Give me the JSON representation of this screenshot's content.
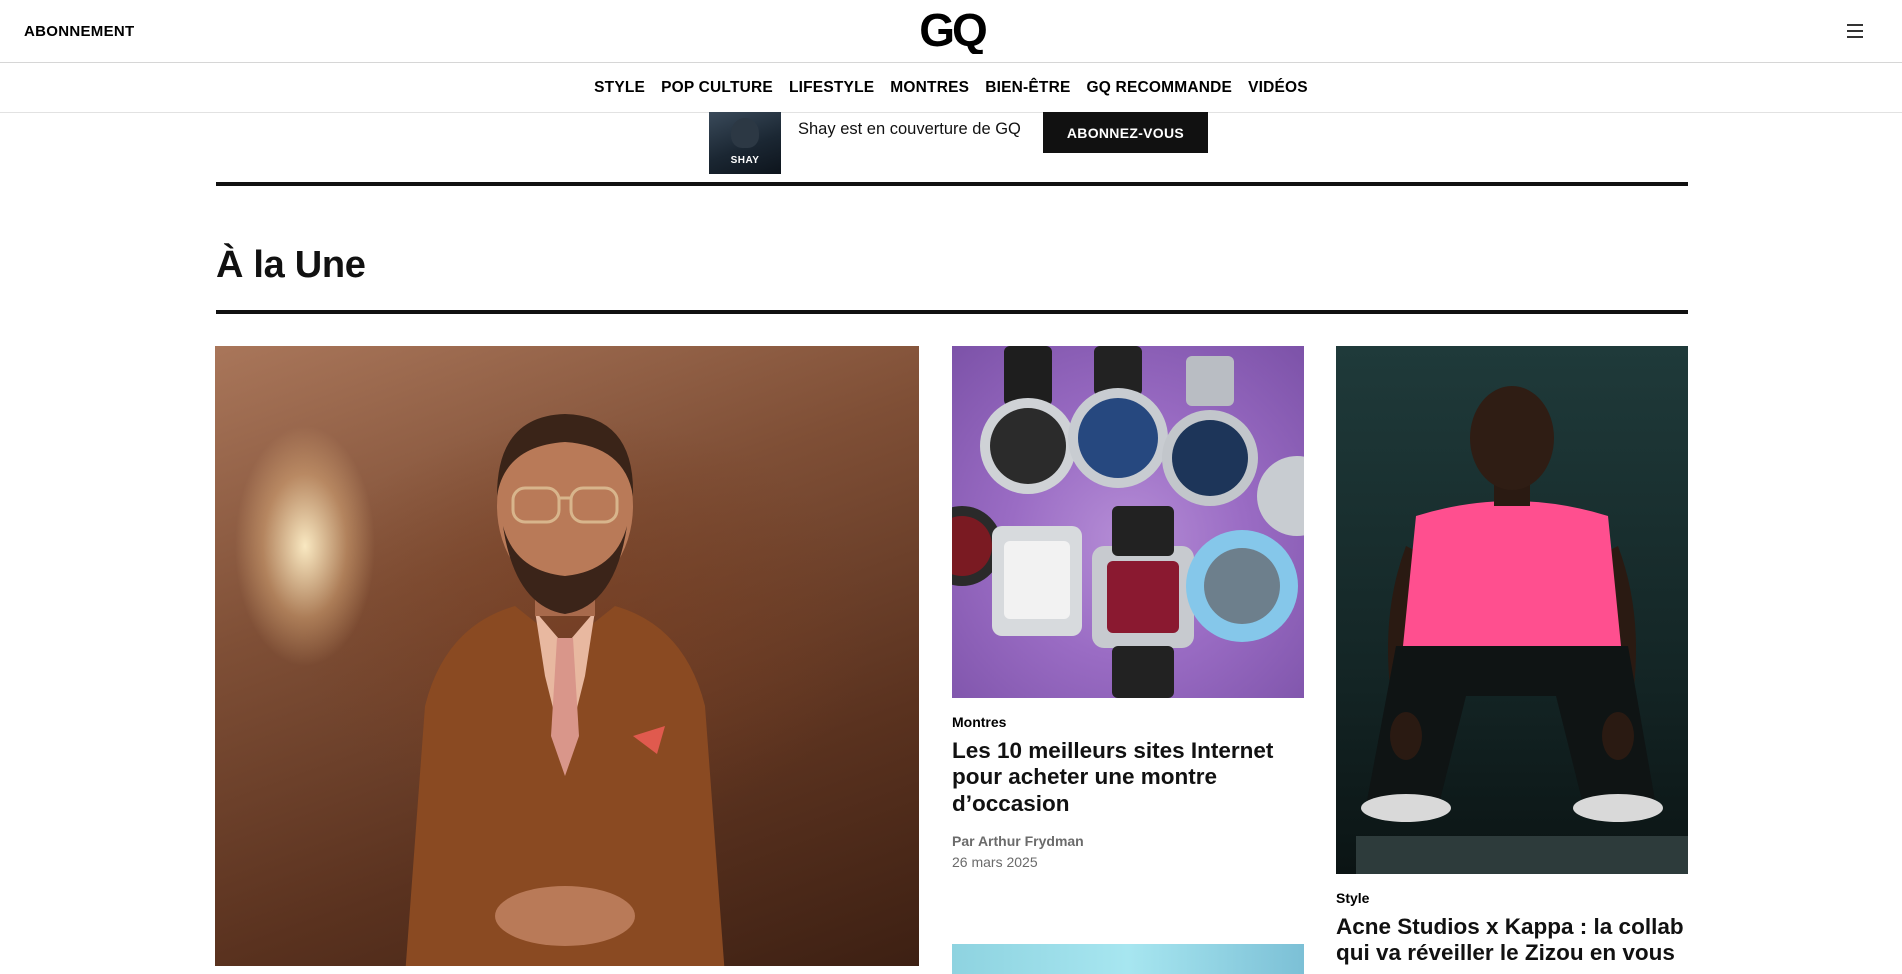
{
  "header": {
    "subscribe_label": "ABONNEMENT",
    "logo_text": "GQ",
    "menu_icon": "hamburger-menu-icon"
  },
  "nav": {
    "items": [
      "STYLE",
      "POP CULTURE",
      "LIFESTYLE",
      "MONTRES",
      "BIEN-ÊTRE",
      "GQ RECOMMANDE",
      "VIDÉOS"
    ]
  },
  "promo": {
    "cover_label": "SHAY",
    "text": "Shay est en couverture de GQ",
    "cta_label": "ABONNEZ-VOUS"
  },
  "section": {
    "title": "À la Une"
  },
  "cards": [
    {
      "kicker": "Montres",
      "headline": "Les 10 meilleurs sites Internet pour acheter une montre d’occasion",
      "author": "Par Arthur Frydman",
      "date": "26 mars 2025"
    },
    {
      "kicker": "Style",
      "headline": "Acne Studios x Kappa : la collab qui va réveiller le Zizou en vous"
    }
  ],
  "colors": {
    "text": "#000000",
    "cta_bg": "#111111",
    "byline": "#6b6b6b",
    "rule": "#111111"
  }
}
